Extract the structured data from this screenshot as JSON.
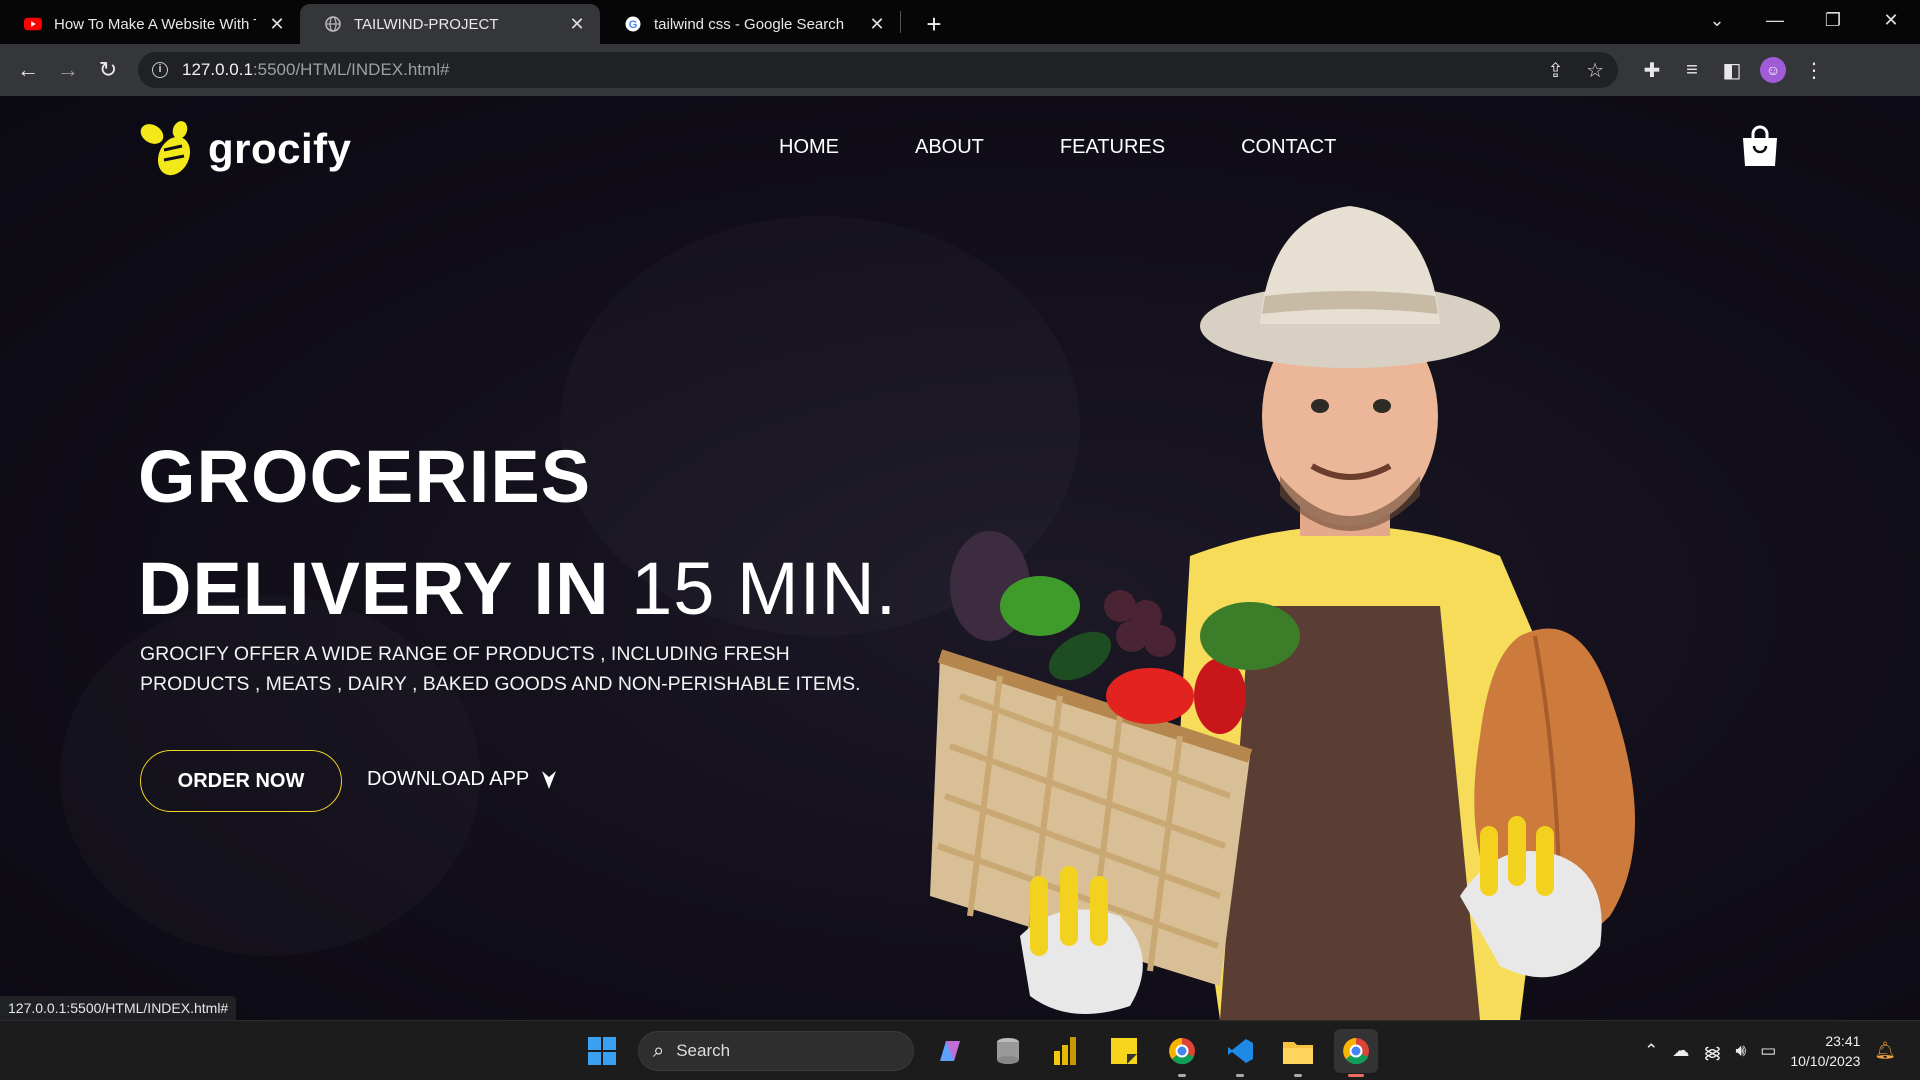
{
  "browser": {
    "tabs": [
      {
        "title": "How To Make A Website With Ta",
        "favicon": "youtube-icon",
        "active": false
      },
      {
        "title": "TAILWIND-PROJECT",
        "favicon": "globe-icon",
        "active": true
      },
      {
        "title": "tailwind css - Google Search",
        "favicon": "google-icon",
        "active": false
      }
    ],
    "new_tab": "+",
    "url_host": "127.0.0.1",
    "url_path": ":5500/HTML/INDEX.html#",
    "status_url": "127.0.0.1:5500/HTML/INDEX.html#"
  },
  "site": {
    "brand": "grocify",
    "nav": [
      "HOME",
      "ABOUT",
      "FEATURES",
      "CONTACT"
    ],
    "hero": {
      "line1": "GROCERIES",
      "line2_bold": "DELIVERY IN",
      "line2_light": "15 MIN.",
      "description": "GROCIFY OFFER A WIDE RANGE OF PRODUCTS , INCLUDING FRESH PRODUCTS , MEATS , DAIRY , BAKED GOODS AND NON-PERISHABLE ITEMS.",
      "order_button": "ORDER NOW",
      "download_link": "DOWNLOAD APP"
    },
    "colors": {
      "accent": "#f5d42a",
      "background": "#110e19"
    }
  },
  "taskbar": {
    "search_placeholder": "Search",
    "time": "23:41",
    "date": "10/10/2023"
  }
}
